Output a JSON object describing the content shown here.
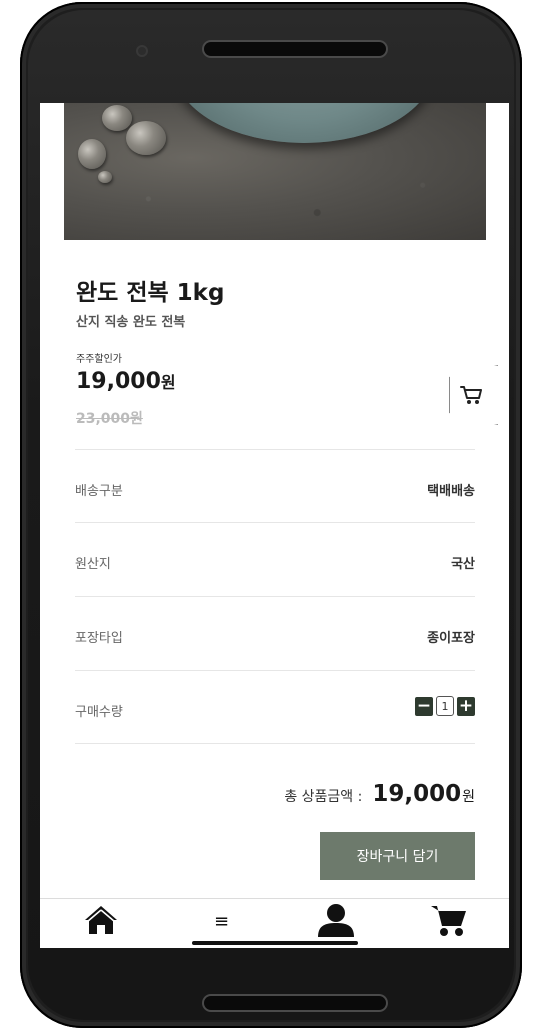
{
  "product": {
    "title": "완도 전복 1kg",
    "subtitle": "산지 직송 완도 전복",
    "discount_label": "주주할인가",
    "price": "19,000",
    "price_unit": "원",
    "original_price": "23,000원"
  },
  "info_rows": [
    {
      "label": "배송구분",
      "value": "택배배송"
    },
    {
      "label": "원산지",
      "value": "국산"
    },
    {
      "label": "포장타입",
      "value": "종이포장"
    }
  ],
  "quantity": {
    "label": "구매수량",
    "value": "1",
    "minus": "−",
    "plus": "+"
  },
  "total": {
    "label": "총 상품금액 :",
    "value": "19,000",
    "unit": "원"
  },
  "actions": {
    "add_to_cart": "장바구니 담기"
  },
  "nav": {
    "menu_glyph": "≡",
    "icons": [
      "home-icon",
      "menu-icon",
      "user-icon",
      "cart-icon"
    ]
  },
  "colors": {
    "primary_button": "#6d7a6c",
    "stepper": "#2e3a2f"
  }
}
